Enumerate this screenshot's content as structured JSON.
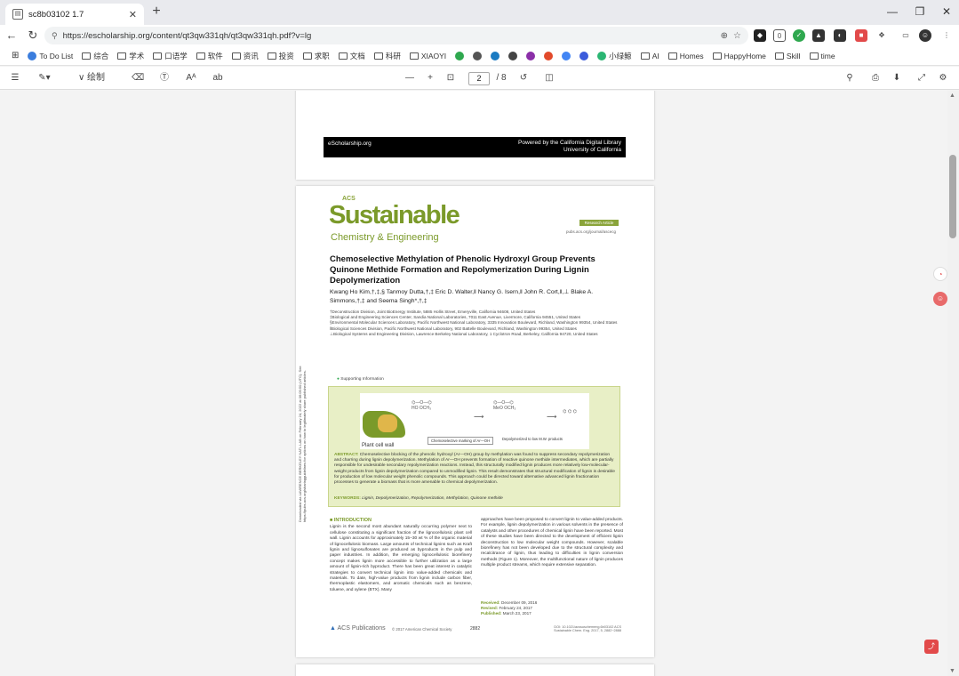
{
  "tab": {
    "title": "sc8b03102 1.7"
  },
  "address": {
    "url": "https://escholarship.org/content/qt3qw331qh/qt3qw331qh.pdf?v=lg"
  },
  "bookmarks": [
    {
      "label": "",
      "kind": "apps"
    },
    {
      "label": "To Do List",
      "kind": "fav",
      "color": "#3b7ddd"
    },
    {
      "label": "综合",
      "kind": "folder"
    },
    {
      "label": "学术",
      "kind": "folder"
    },
    {
      "label": "口语学",
      "kind": "folder"
    },
    {
      "label": "软件",
      "kind": "folder"
    },
    {
      "label": "资讯",
      "kind": "folder"
    },
    {
      "label": "投资",
      "kind": "folder"
    },
    {
      "label": "求职",
      "kind": "folder"
    },
    {
      "label": "文档",
      "kind": "folder"
    },
    {
      "label": "科研",
      "kind": "folder"
    },
    {
      "label": "XIAOYI",
      "kind": "folder"
    },
    {
      "label": "",
      "kind": "fav",
      "color": "#2fa84f"
    },
    {
      "label": "",
      "kind": "fav",
      "color": "#555"
    },
    {
      "label": "",
      "kind": "fav",
      "color": "#1b7bc2"
    },
    {
      "label": "",
      "kind": "fav",
      "color": "#444"
    },
    {
      "label": "",
      "kind": "fav",
      "color": "#8b2fa8"
    },
    {
      "label": "",
      "kind": "fav",
      "color": "#e24a2b"
    },
    {
      "label": "",
      "kind": "fav",
      "color": "#4285f4"
    },
    {
      "label": "",
      "kind": "fav",
      "color": "#3b5bdb"
    },
    {
      "label": "小绿鲸",
      "kind": "fav",
      "color": "#2bb673"
    },
    {
      "label": "AI",
      "kind": "folder"
    },
    {
      "label": "Homes",
      "kind": "folder"
    },
    {
      "label": "HappyHome",
      "kind": "folder"
    },
    {
      "label": "Skill",
      "kind": "folder"
    },
    {
      "label": "time",
      "kind": "folder"
    }
  ],
  "pdf_toolbar": {
    "draw_label": "绘制",
    "page_current": "2",
    "page_total": "/ 8",
    "zoom_minus": "—",
    "zoom_plus": "+"
  },
  "page1": {
    "footer_left": "eScholarship.org",
    "footer_right_1": "Powered by the California Digital Library",
    "footer_right_2": "University of California"
  },
  "page2": {
    "journal_acs": "ACS",
    "journal_main": "Sustainable",
    "journal_sub": "Chemistry & Engineering",
    "badge": "Research Article",
    "doi_link": "pubs.acs.org/journal/ascecg",
    "title": "Chemoselective Methylation of Phenolic Hydroxyl Group Prevents Quinone Methide Formation and Repolymerization During Lignin Depolymerization",
    "authors": "Kwang Ho Kim,†,‡,§ Tanmoy Dutta,†,‡ Eric D. Walter,‖ Nancy G. Isern,‖ John R. Cort,‖,⊥ Blake A. Simmons,†,‡ and Seema Singh*,†,‡",
    "affiliations": [
      "†Deconstruction Division, Joint BioEnergy Institute, 5885 Hollis Street, Emeryville, California 94608, United States",
      "‡Biological and Engineering Sciences Center, Sandia National Laboratories, 7011 East Avenue, Livermore, California 94551, United States",
      "§Environmental Molecular Sciences Laboratory, Pacific Northwest National Laboratory, 3335 Innovation Boulevard, Richland, Washington 99354, United States",
      "‖Biological Sciences Division, Pacific Northwest National Laboratory, 902 Battelle Boulevard, Richland, Washington 99354, United States",
      "⊥Biological Systems and Engineering Division, Lawrence Berkeley National Laboratory, 1 Cyclotron Road, Berkeley, California 94720, United States"
    ],
    "support": "Supporting Information",
    "toc_caption": "Plant cell wall",
    "toc_label_1": "Chemoselective marking of Ar—OH",
    "toc_label_2": "Depolymerized to low M.W. products",
    "abstract_head": "ABSTRACT:",
    "abstract": "Chemoselective blocking of the phenolic hydroxyl (Ar—OH) group by methylation was found to suppress secondary repolymerization and charring during lignin depolymerization. Methylation of Ar—OH prevents formation of reactive quinone methide intermediates, which are partially responsible for undesirable secondary repolymerization reactions. Instead, this structurally modified lignin produces more relatively low-molecular-weight products from lignin depolymerization compared to unmodified lignin. This result demonstrates that structural modification of lignin is desirable for production of low molecular weight phenolic compounds. This approach could be directed toward alternative advanced lignin fractionation processes to generate a biomass that is more amenable to chemical depolymerization.",
    "keywords_head": "KEYWORDS:",
    "keywords": "Lignin, Depolymerization, Repolymerization, Methylation, Quinone methide",
    "side_notice": "Downloaded via LAWRENCE BERKELEY NATL LAB on February 24, 2022 at 06:09:50 (UTC). See https://pubs.acs.org/sharingguidelines for options on how to legitimately share published articles.",
    "intro_head": "■ INTRODUCTION",
    "intro_left": "Lignin is the second most abundant naturally occurring polymer next to cellulose constituting a significant fraction of the lignocellulosic plant cell wall. Lignin accounts for approximately 15−30 wt % of the organic material of lignocellulosic biomass. Large amounts of technical lignins such as Kraft lignin and lignosulfonates are produced as byproducts in the pulp and paper industries. In addition, the emerging lignocellulosic biorefinery concept makes lignin more accessible to further utilization as a large amount of lignin-rich byproduct. There has been great interest in catalytic strategies to convert technical lignin into value-added chemicals and materials. To date, high-value products from lignin include carbon fiber, thermoplastic elastomers, and aromatic chemicals such as benzene, toluene, and xylene (BTX). Many",
    "intro_right": "approaches have been proposed to convert lignin to value-added products. For example, lignin depolymerization in various solvents in the presence of catalysts and other procedures of chemical lignin have been reported. Most of these studies have been directed to the development of efficient lignin deconstruction to low molecular weight compounds. However, scalable biorefinery has not been developed due to the structural complexity and recalcitrance of lignin, thus leading to difficulties in lignin conversion methods (Figure 1). Moreover, the multifunctional nature of lignin produces multiple product streams, which require extensive separation.",
    "received_label": "Received:",
    "received": "December 09, 2016",
    "revised_label": "Revised:",
    "revised": "February 24, 2017",
    "published_label": "Published:",
    "published": "March 23, 2017",
    "publisher": "ACS Publications",
    "copyright": "© 2017 American Chemical Society",
    "page_number": "2882",
    "page_doi": "DOI: 10.1021/acssuschemeng.6b03102 ACS Sustainable Chem. Eng. 2017, 5, 2882−2888"
  }
}
